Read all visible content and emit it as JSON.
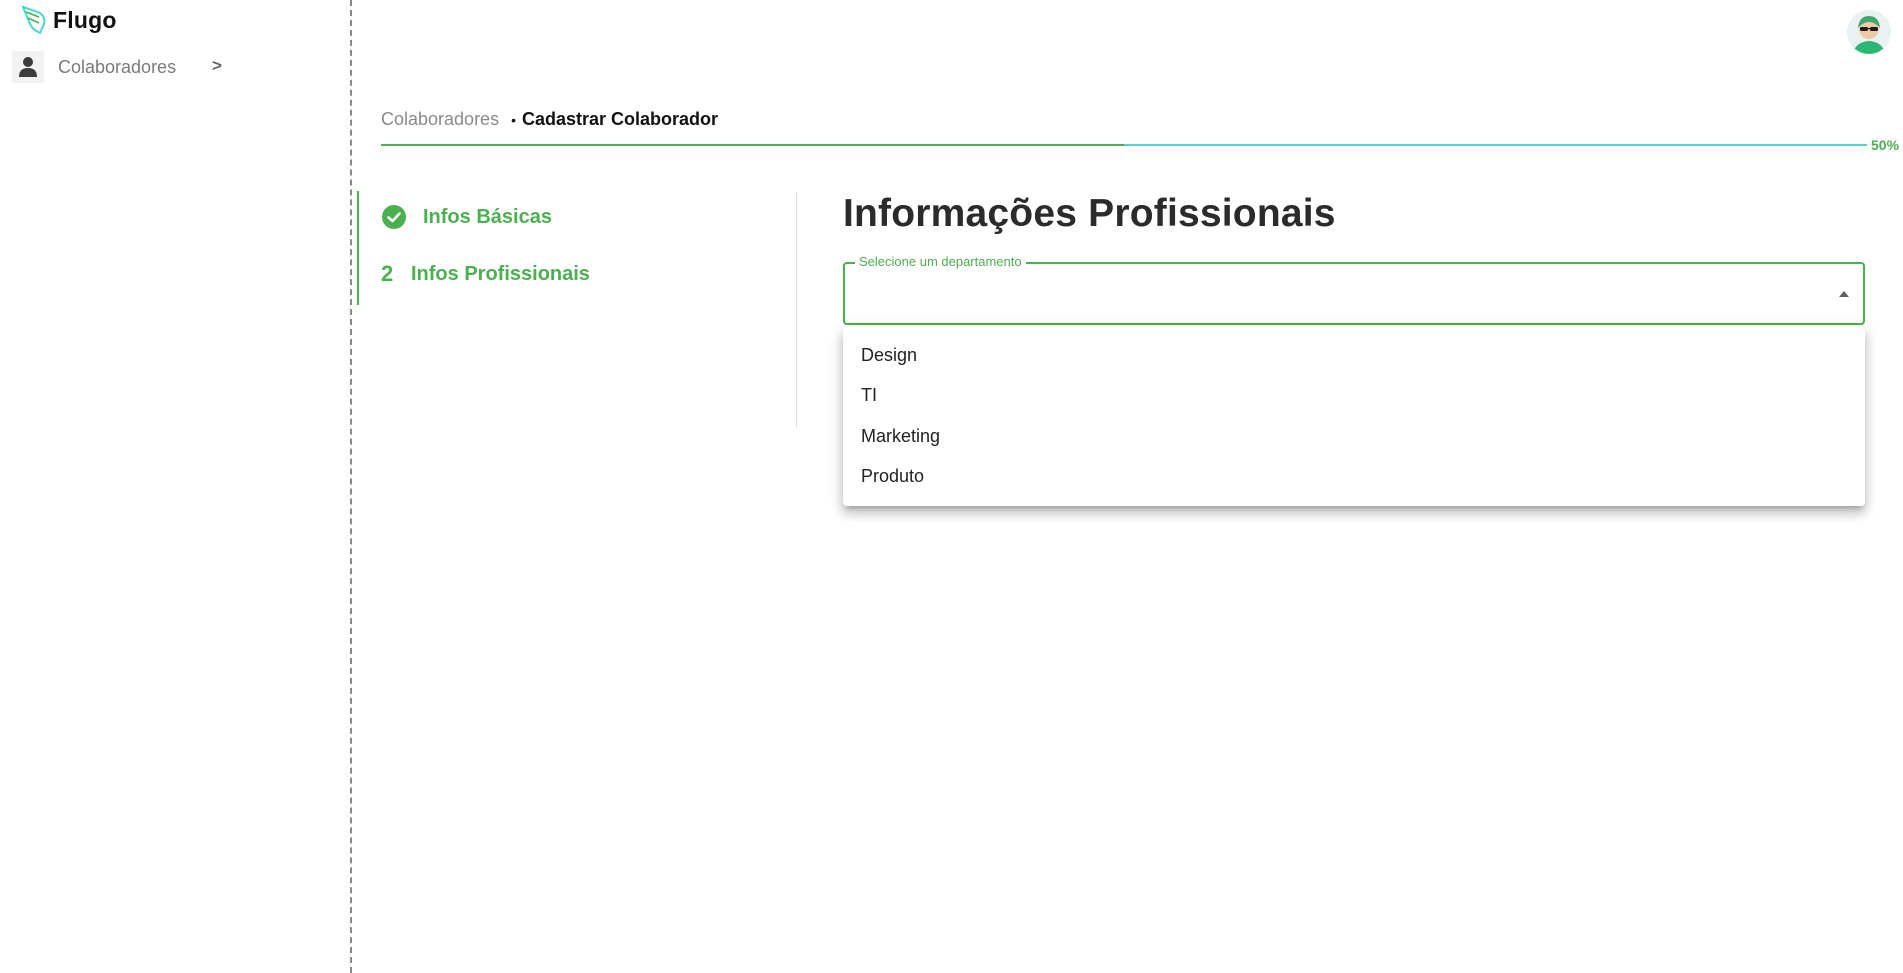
{
  "app": {
    "name": "Flugo",
    "brand_color": "#4caf50",
    "accent_color": "#4ad7d1"
  },
  "sidebar": {
    "items": [
      {
        "label": "Colaboradores",
        "icon": "person-icon",
        "chevron": ">"
      }
    ]
  },
  "header": {
    "avatar": "user-avatar"
  },
  "breadcrumb": {
    "parent": "Colaboradores",
    "separator": "•",
    "current": "Cadastrar Colaborador"
  },
  "progress": {
    "value_percent": 50,
    "label": "50%"
  },
  "stepper": {
    "steps": [
      {
        "label": "Infos Básicas",
        "status": "completed",
        "icon": "check-circle-icon"
      },
      {
        "number": "2",
        "label": "Infos Profissionais",
        "status": "active"
      }
    ]
  },
  "form": {
    "title": "Informações Profissionais",
    "department_select": {
      "label": "Selecione um departamento",
      "value": "",
      "open": true,
      "options": [
        "Design",
        "TI",
        "Marketing",
        "Produto"
      ]
    }
  }
}
